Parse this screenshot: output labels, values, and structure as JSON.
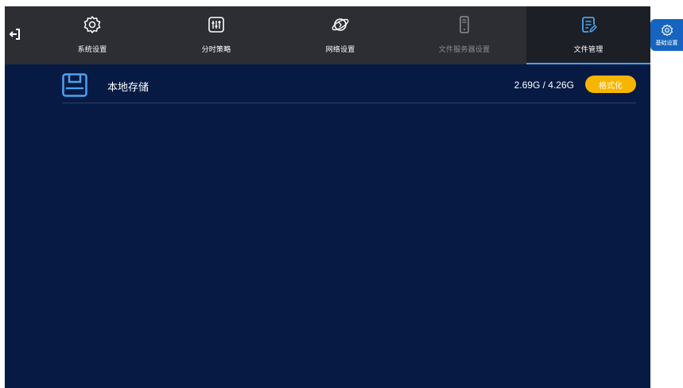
{
  "header": {
    "back_icon": "exit-arrow-icon",
    "tabs": [
      {
        "label": "系统设置",
        "icon": "gear-icon",
        "state": "normal"
      },
      {
        "label": "分时策略",
        "icon": "sliders-icon",
        "state": "normal"
      },
      {
        "label": "网络设置",
        "icon": "planet-icon",
        "state": "normal"
      },
      {
        "label": "文件服务器设置",
        "icon": "server-icon",
        "state": "disabled"
      },
      {
        "label": "文件管理",
        "icon": "document-edit-icon",
        "state": "active"
      }
    ]
  },
  "side_button": {
    "label": "基础设置",
    "icon": "gear-icon"
  },
  "storage": {
    "name": "本地存储",
    "usage": "2.69G / 4.26G",
    "format_label": "格式化",
    "icon": "floppy-disk-icon"
  },
  "colors": {
    "background": "#061a44",
    "topbar": "#2c2e33",
    "active_tab": "#1c1f26",
    "accent": "#4aa3f0",
    "format_button": "#f7b500",
    "side_button": "#1565c0"
  }
}
